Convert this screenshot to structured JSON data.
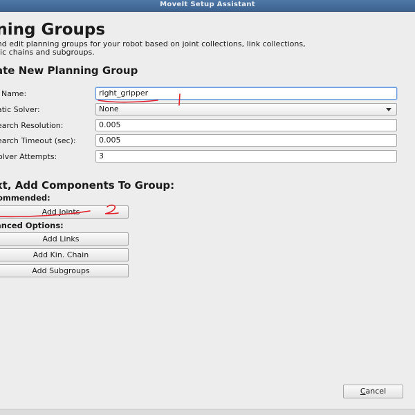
{
  "window": {
    "title": "MoveIt Setup Assistant"
  },
  "page": {
    "title": "nning Groups",
    "description_line1": "and edit planning groups for your robot based on joint collections, link collections,",
    "description_line2": "atic chains and subgroups."
  },
  "form": {
    "section_title": "ate New Planning Group",
    "group_name": {
      "label": "Name:",
      "value": "right_gripper"
    },
    "kinematic_solver": {
      "label": "atic Solver:",
      "value": "None"
    },
    "search_resolution": {
      "label": "earch Resolution:",
      "value": "0.005"
    },
    "search_timeout": {
      "label": "earch Timeout (sec):",
      "value": "0.005"
    },
    "solver_attempts": {
      "label": "olver Attempts:",
      "value": "3"
    }
  },
  "components": {
    "section_title": "xt, Add Components To Group:",
    "recommended_label": "ommended:",
    "add_joints_label": "Add Joints",
    "advanced_label": "anced Options:",
    "add_links_label": "Add Links",
    "add_chain_label": "Add Kin. Chain",
    "add_subgroups_label": "Add Subgroups"
  },
  "footer": {
    "cancel_label_first": "C",
    "cancel_label_rest": "ancel"
  },
  "colors": {
    "annotation": "#e0202a",
    "titlebar": "#4a71a0",
    "focus": "#6b9bd8"
  }
}
